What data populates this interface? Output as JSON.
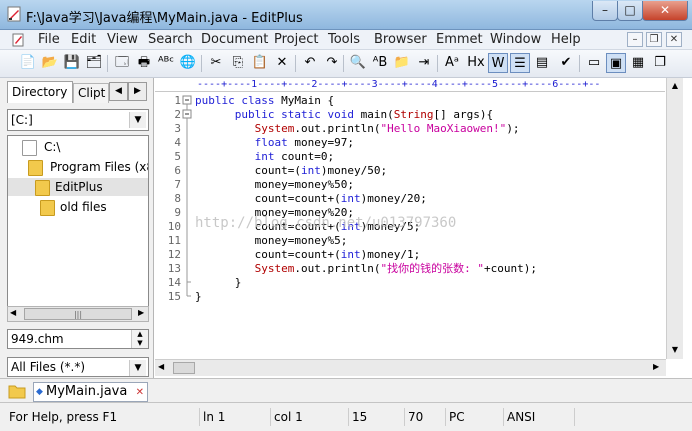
{
  "window": {
    "title": "F:\\Java学习\\Java编程\\MyMain.java - EditPlus",
    "min": "–",
    "max": "□",
    "close": "✕"
  },
  "menu": [
    "File",
    "Edit",
    "View",
    "Search",
    "Document",
    "Project",
    "Tools",
    "Browser",
    "Emmet",
    "Window",
    "Help"
  ],
  "mdi": {
    "min": "–",
    "restore": "❐",
    "close": "✕"
  },
  "toolbar": {
    "icons": [
      "new-file-icon",
      "open-folder-icon",
      "save-icon",
      "save-all-icon",
      "print-preview-icon",
      "print-icon",
      "spell-check-icon",
      "browser-preview-icon",
      "cut-icon",
      "copy-icon",
      "paste-icon",
      "delete-icon",
      "undo-icon",
      "redo-icon",
      "find-icon",
      "replace-icon",
      "find-in-files-icon",
      "goto-line-icon",
      "font-icon",
      "hex-icon",
      "word-wrap-icon",
      "line-number-icon",
      "ruler-icon",
      "check-icon",
      "output-window-icon",
      "directory-window-icon",
      "cliptext-icon",
      "new-window-icon"
    ],
    "glyphs": [
      "📄",
      "📂",
      "💾",
      "🗂",
      "🗔",
      "🖶",
      "ᴬᴮᶜ",
      "🌐",
      "✂",
      "⎘",
      "📋",
      "✕",
      "↶",
      "↷",
      "🔍",
      "ᴬB",
      "📁",
      "⇥",
      "Aᵃ",
      "Hx",
      "W",
      "☰",
      "▤",
      "✔",
      "▭",
      "▣",
      "▦",
      "❐"
    ]
  },
  "left_panel": {
    "tab_directory": "Directory",
    "tab_cliptext": "Clipt",
    "drive": "[C:]",
    "tree": [
      {
        "label": "C:\\",
        "indent": 0,
        "selected": false
      },
      {
        "label": "Program Files (x8",
        "indent": 1,
        "selected": false
      },
      {
        "label": "EditPlus",
        "indent": 2,
        "selected": true
      },
      {
        "label": "old files",
        "indent": 3,
        "selected": false
      }
    ],
    "file_input": "949.chm",
    "filter": "All Files (*.*)"
  },
  "editor": {
    "ruler": "----+----1----+----2----+----3----+----4----+----5----+----6----+--",
    "line_numbers": [
      "1",
      "2",
      "3",
      "4",
      "5",
      "6",
      "7",
      "8",
      "9",
      "10",
      "11",
      "12",
      "13",
      "14",
      "15"
    ],
    "code": [
      "public class MyMain {",
      "      public static void main(String[] args){",
      "         System.out.println(\"Hello MaoXiaowen!\");",
      "         float money=97;",
      "         int count=0;",
      "         count=(int)money/50;",
      "         money=money%50;",
      "         count=count+(int)money/20;",
      "         money=money%20;",
      "         count=count+(int)money/5;",
      "         money=money%5;",
      "         count=count+(int)money/1;",
      "         System.out.println(\"找你的钱的张数: \"+count);",
      "      }",
      "}"
    ],
    "watermark": "http://blog.csdn.net/u013797360"
  },
  "file_tab": {
    "label": "MyMain.java",
    "close": "✕"
  },
  "status": {
    "help": "For Help, press F1",
    "line": "ln 1",
    "col": "col 1",
    "lines": "15",
    "chars": "70",
    "mode": "PC",
    "encoding": "ANSI"
  }
}
